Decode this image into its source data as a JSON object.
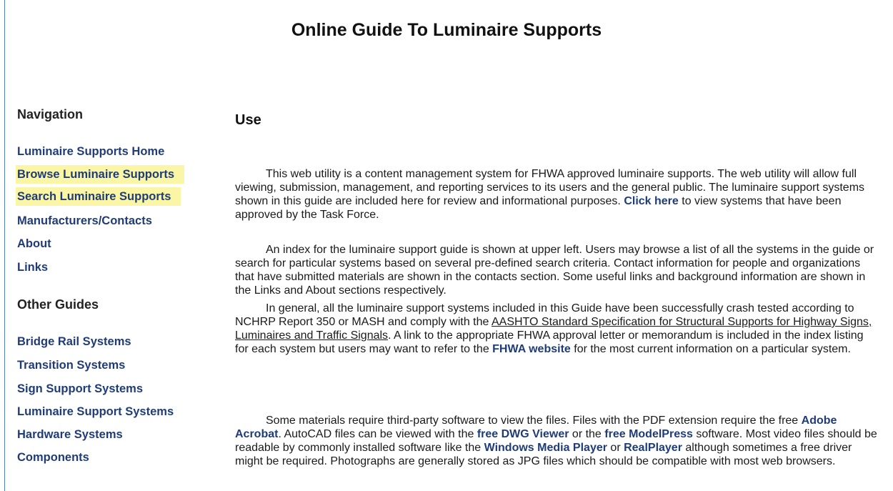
{
  "page": {
    "title": "Online Guide To Luminaire Supports"
  },
  "navigation": {
    "heading": "Navigation",
    "items": [
      "Luminaire Supports Home",
      "Browse Luminaire Supports",
      "Search Luminaire Supports",
      "Manufacturers/Contacts",
      "About",
      "Links"
    ]
  },
  "other_guides": {
    "heading": "Other Guides",
    "items": [
      "Bridge Rail Systems",
      "Transition Systems",
      "Sign Support Systems",
      "Luminaire Support Systems",
      "Hardware Systems",
      "Components"
    ]
  },
  "content": {
    "heading": "Use",
    "p1": {
      "a": "This web utility is a content management system for FHWA approved luminaire supports. The web utility will allow full viewing, submission, management, and reporting services to its users and the general public. The luminaire support systems shown in this guide are included here for review and informational purposes. ",
      "link": "Click here",
      "b": " to view systems that have been approved by the Task Force."
    },
    "p2": "An index for the luminaire support guide is shown at upper left. Users may browse a list of all the systems in the guide or search for particular systems based on several pre-defined search criteria. Contact information for people and organizations that have submitted materials are shown in the contacts section. Some useful links and background information are shown in the Links and About sections respectively.",
    "p3": {
      "a": "In general, all the luminaire support systems included in this Guide have been successfully crash tested according to NCHRP Report 350 or MASH and comply with the ",
      "underlined": "AASHTO Standard Specification for Structural Supports for Highway Signs, Luminaires and Traffic Signals",
      "b": ". A link to the appropriate FHWA approval letter or memorandum is included in the index listing for each system but users may want to refer to the ",
      "link": "FHWA website",
      "c": " for the most current information on a particular system."
    },
    "p4": {
      "a": "Some materials require third-party software to view the files. Files with the PDF extension require the free ",
      "link1": "Adobe Acrobat",
      "b": ". AutoCAD files can be viewed with the ",
      "link2": "free DWG Viewer",
      "c": " or the ",
      "link3": "free ModelPress",
      "d": " software. Most video files should be readable by commonly installed software like the ",
      "link4": "Windows Media Player",
      "e": " or ",
      "link5": "RealPlayer",
      "f": " although sometimes a free driver might be required. Photographs are generally stored as JPG files which should be compatible with most web browsers."
    }
  },
  "colors": {
    "link": "#1f3c78",
    "highlight": "#fbf6a6",
    "left_rule": "#4f7fbf"
  }
}
